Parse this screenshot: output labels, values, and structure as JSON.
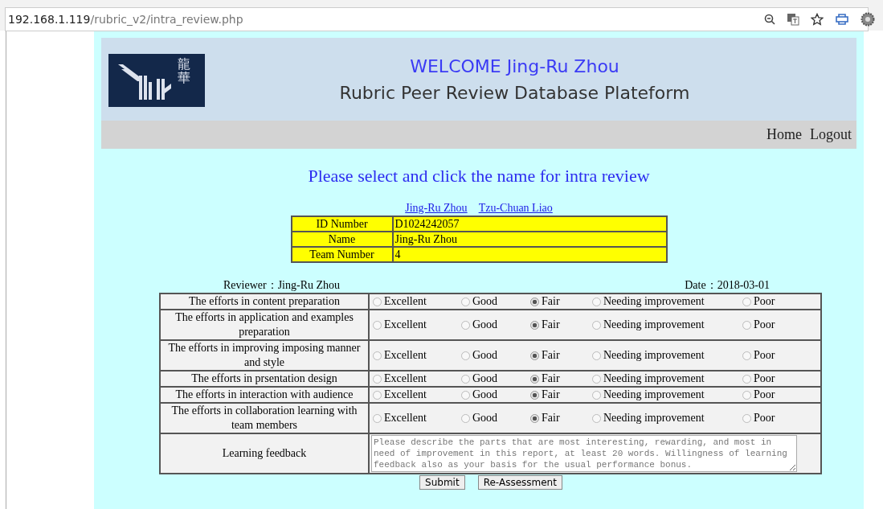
{
  "browser": {
    "address_host": "192.168.1.119",
    "address_path": "/rubric_v2/intra_review.php"
  },
  "header": {
    "logo_text": "龍華",
    "welcome": "WELCOME  Jing-Ru Zhou",
    "title": "Rubric Peer Review Database Plateform"
  },
  "nav": [
    "Home",
    "Logout"
  ],
  "prompt": "Please select and click the name for intra review",
  "members": [
    "Jing-Ru Zhou",
    "Tzu-Chuan Liao"
  ],
  "info": [
    {
      "label": "ID Number",
      "value": "D1024242057"
    },
    {
      "label": "Name",
      "value": "Jing-Ru Zhou"
    },
    {
      "label": "Team Number",
      "value": "4"
    }
  ],
  "reviewer": "Reviewer：Jing-Ru Zhou",
  "date": "Date：2018-03-01",
  "criteria": [
    {
      "label": "The efforts in content preparation",
      "options": [
        {
          "label": "Excellent",
          "selected": false
        },
        {
          "label": "Good",
          "selected": false
        },
        {
          "label": "Fair",
          "selected": true
        },
        {
          "label": "Needing improvement",
          "selected": false
        },
        {
          "label": "Poor",
          "selected": false
        }
      ]
    },
    {
      "label": "The efforts in application and examples preparation",
      "options": [
        {
          "label": "Excellent",
          "selected": false
        },
        {
          "label": "Good",
          "selected": false
        },
        {
          "label": "Fair",
          "selected": true
        },
        {
          "label": "Needing improvement",
          "selected": false
        },
        {
          "label": "Poor",
          "selected": false
        }
      ]
    },
    {
      "label": "The efforts in improving imposing manner and style",
      "options": [
        {
          "label": "Excellent",
          "selected": false
        },
        {
          "label": "Good",
          "selected": false
        },
        {
          "label": "Fair",
          "selected": true
        },
        {
          "label": "Needing improvement",
          "selected": false
        },
        {
          "label": "Poor",
          "selected": false
        }
      ]
    },
    {
      "label": "The efforts in prsentation design",
      "options": [
        {
          "label": "Excellent",
          "selected": false
        },
        {
          "label": "Good",
          "selected": false
        },
        {
          "label": "Fair",
          "selected": true
        },
        {
          "label": "Needing improvement",
          "selected": false
        },
        {
          "label": "Poor",
          "selected": false
        }
      ]
    },
    {
      "label": "The efforts in interaction with audience",
      "options": [
        {
          "label": "Excellent",
          "selected": false
        },
        {
          "label": "Good",
          "selected": false
        },
        {
          "label": "Fair",
          "selected": true
        },
        {
          "label": "Needing improvement",
          "selected": false
        },
        {
          "label": "Poor",
          "selected": false
        }
      ]
    },
    {
      "label": "The efforts in collaboration learning with team members",
      "options": [
        {
          "label": "Excellent",
          "selected": false
        },
        {
          "label": "Good",
          "selected": false
        },
        {
          "label": "Fair",
          "selected": true
        },
        {
          "label": "Needing improvement",
          "selected": false
        },
        {
          "label": "Poor",
          "selected": false
        }
      ]
    }
  ],
  "feedback": {
    "label": "Learning feedback",
    "placeholder": "Please describe the parts that are most interesting, rewarding, and most in need of improvement in this report, at least 20 words. Willingness of learning feedback also as your basis for the usual performance bonus."
  },
  "buttons": [
    "Submit",
    "Re-Assessment"
  ]
}
